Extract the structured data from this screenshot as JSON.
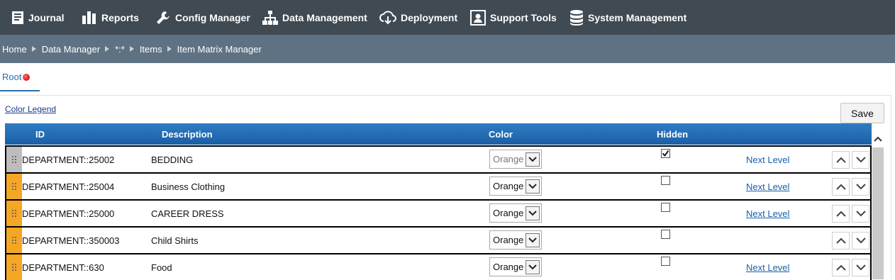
{
  "nav": {
    "items": [
      {
        "label": "Journal",
        "icon": "book-icon"
      },
      {
        "label": "Reports",
        "icon": "bar-chart-icon"
      },
      {
        "label": "Config Manager",
        "icon": "wrench-icon"
      },
      {
        "label": "Data Management",
        "icon": "sitemap-icon"
      },
      {
        "label": "Deployment",
        "icon": "cloud-download-icon"
      },
      {
        "label": "Support Tools",
        "icon": "user-badge-icon"
      },
      {
        "label": "System Management",
        "icon": "database-icon"
      }
    ]
  },
  "breadcrumb": [
    "Home",
    "Data Manager",
    "*:*",
    "Items",
    "Item Matrix Manager"
  ],
  "tabs": {
    "root_label": "Root"
  },
  "toolbar": {
    "color_legend": "Color Legend",
    "save_label": "Save"
  },
  "grid": {
    "headers": {
      "id": "ID",
      "description": "Description",
      "color": "Color",
      "hidden": "Hidden"
    },
    "rows": [
      {
        "id": "DEPARTMENT::25002",
        "description": "BEDDING",
        "color": "Orange",
        "hidden": true,
        "next_level": "Next Level"
      },
      {
        "id": "DEPARTMENT::25004",
        "description": "Business Clothing",
        "color": "Orange",
        "hidden": false,
        "next_level": "Next Level"
      },
      {
        "id": "DEPARTMENT::25000",
        "description": "CAREER DRESS",
        "color": "Orange",
        "hidden": false,
        "next_level": "Next Level"
      },
      {
        "id": "DEPARTMENT::350003",
        "description": "Child Shirts",
        "color": "Orange",
        "hidden": false,
        "next_level": ""
      },
      {
        "id": "DEPARTMENT::630",
        "description": "Food",
        "color": "Orange",
        "hidden": false,
        "next_level": "Next Level"
      }
    ]
  },
  "colors": {
    "nav_bg": "#3f4a53",
    "breadcrumb_bg": "#5f7283",
    "header_blue": "#1b5fa5",
    "row_handle": "#f5a623",
    "link": "#1a5ea8"
  }
}
